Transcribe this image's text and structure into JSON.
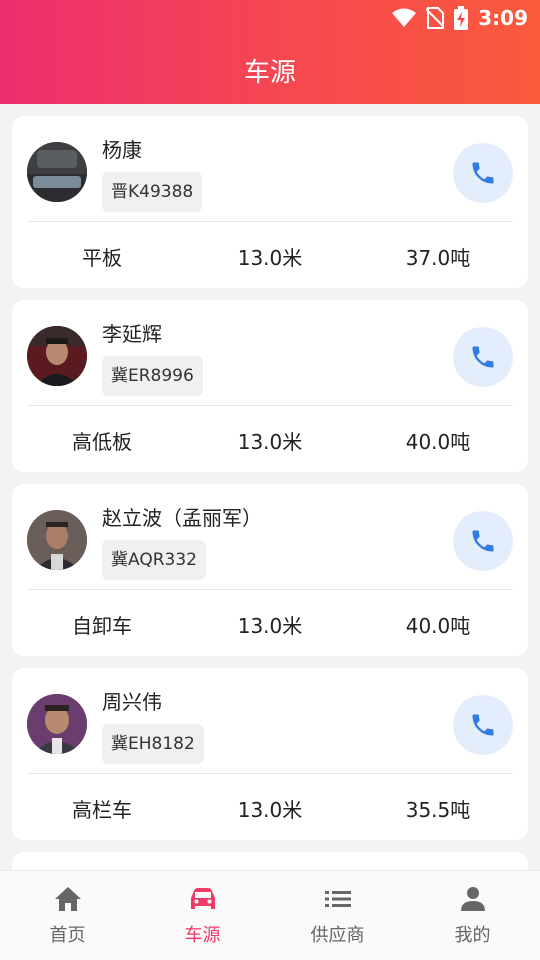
{
  "status_bar": {
    "time": "3:09"
  },
  "header": {
    "title": "车源"
  },
  "vehicles": [
    {
      "name": "杨康",
      "plate": "晋K49388",
      "type": "平板",
      "length": "13.0米",
      "load": "37.0吨"
    },
    {
      "name": "李延辉",
      "plate": "冀ER8996",
      "type": "高低板",
      "length": "13.0米",
      "load": "40.0吨"
    },
    {
      "name": "赵立波（孟丽军）",
      "plate": "冀AQR332",
      "type": "自卸车",
      "length": "13.0米",
      "load": "40.0吨"
    },
    {
      "name": "周兴伟",
      "plate": "冀EH8182",
      "type": "高栏车",
      "length": "13.0米",
      "load": "35.5吨"
    }
  ],
  "tabs": [
    {
      "label": "首页",
      "icon": "home-icon"
    },
    {
      "label": "车源",
      "icon": "car-icon",
      "active": true
    },
    {
      "label": "供应商",
      "icon": "list-icon"
    },
    {
      "label": "我的",
      "icon": "person-icon"
    }
  ],
  "colors": {
    "accent": "#ee3a67",
    "call_bg": "#e3edfc",
    "call_icon": "#2f7de1"
  }
}
